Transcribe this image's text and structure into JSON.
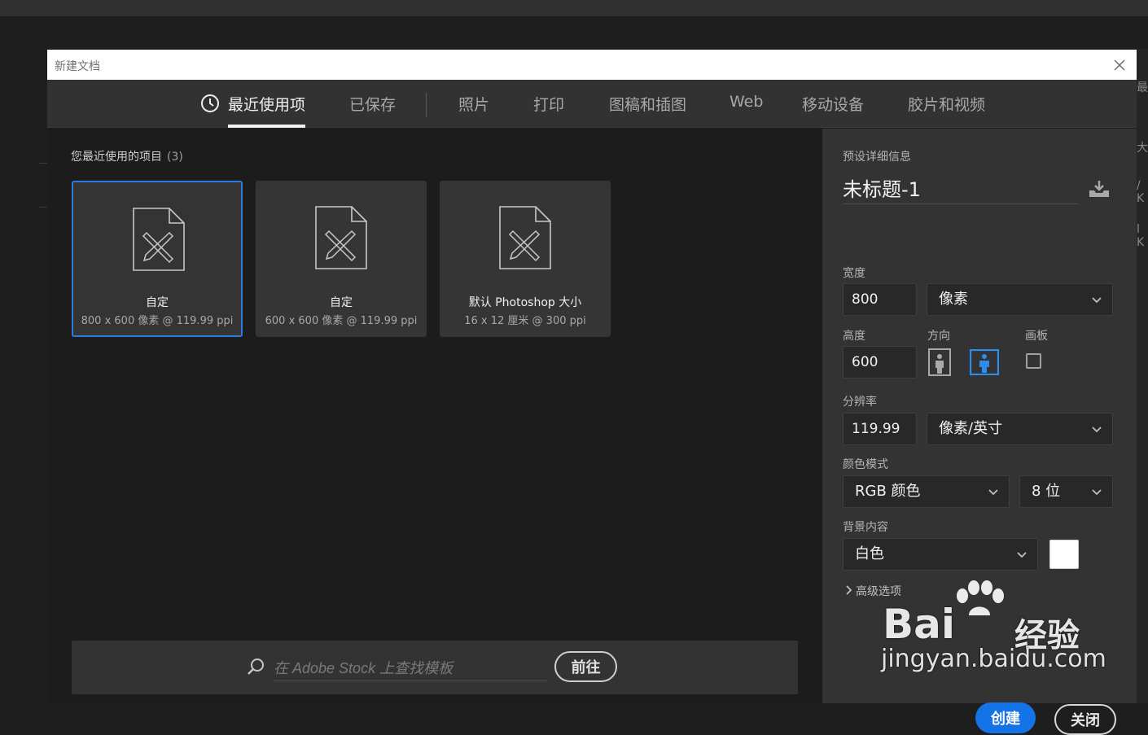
{
  "dialog": {
    "title": "新建文档"
  },
  "tabs": [
    {
      "label": "最近使用项",
      "active": true
    },
    {
      "label": "已保存",
      "active": false
    },
    {
      "label": "照片",
      "active": false
    },
    {
      "label": "打印",
      "active": false
    },
    {
      "label": "图稿和插图",
      "active": false
    },
    {
      "label": "Web",
      "active": false
    },
    {
      "label": "移动设备",
      "active": false
    },
    {
      "label": "胶片和视频",
      "active": false
    }
  ],
  "recent": {
    "title": "您最近使用的项目",
    "count": "(3)",
    "items": [
      {
        "name": "自定",
        "info": "800 x 600 像素 @ 119.99 ppi",
        "selected": true
      },
      {
        "name": "自定",
        "info": "600 x 600 像素 @ 119.99 ppi",
        "selected": false
      },
      {
        "name": "默认 Photoshop 大小",
        "info": "16 x 12 厘米 @ 300 ppi",
        "selected": false
      }
    ]
  },
  "search": {
    "placeholder": "在 Adobe Stock 上查找模板",
    "go_label": "前往"
  },
  "preset": {
    "header": "预设详细信息",
    "doc_name": "未标题-1",
    "width_label": "宽度",
    "width_value": "800",
    "width_unit": "像素",
    "height_label": "高度",
    "height_value": "600",
    "orientation_label": "方向",
    "orientation_selected": "landscape",
    "artboard_label": "画板",
    "artboard_checked": false,
    "resolution_label": "分辨率",
    "resolution_value": "119.99",
    "resolution_unit": "像素/英寸",
    "color_mode_label": "颜色模式",
    "color_mode": "RGB 颜色",
    "bit_depth": "8 位",
    "background_label": "背景内容",
    "background": "白色",
    "background_color": "#ffffff",
    "advanced_label": "高级选项",
    "create_label": "创建",
    "close_label": "关闭"
  },
  "background_app": {
    "peek_text": [
      "最",
      "大",
      "/ K",
      "l K"
    ]
  },
  "watermark": {
    "logo": "Bai",
    "logo_cn": "经验",
    "url": "jingyan.baidu.com"
  },
  "colors": {
    "accent": "#1473e6",
    "selection_border": "#2c7ae3"
  }
}
